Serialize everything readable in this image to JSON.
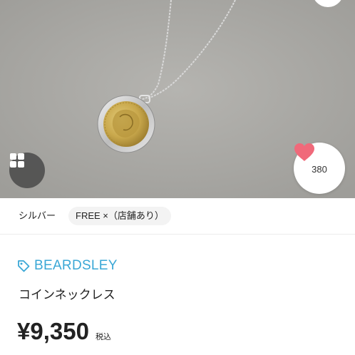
{
  "product_image": {
    "icon": "coin-necklace-photo",
    "gallery_button_icon": "grid-icon",
    "like": {
      "icon": "heart-icon",
      "count": "380",
      "color": "#f0697a"
    }
  },
  "variants": {
    "color_label": "シルバー",
    "size_label": "FREE ×（店舗あり）"
  },
  "brand": {
    "icon": "tag-icon",
    "name": "BEARDSLEY",
    "color": "#3aa7d6"
  },
  "product": {
    "name": "コインネックレス"
  },
  "price": {
    "value": "¥9,350",
    "tax_label": "税込"
  }
}
